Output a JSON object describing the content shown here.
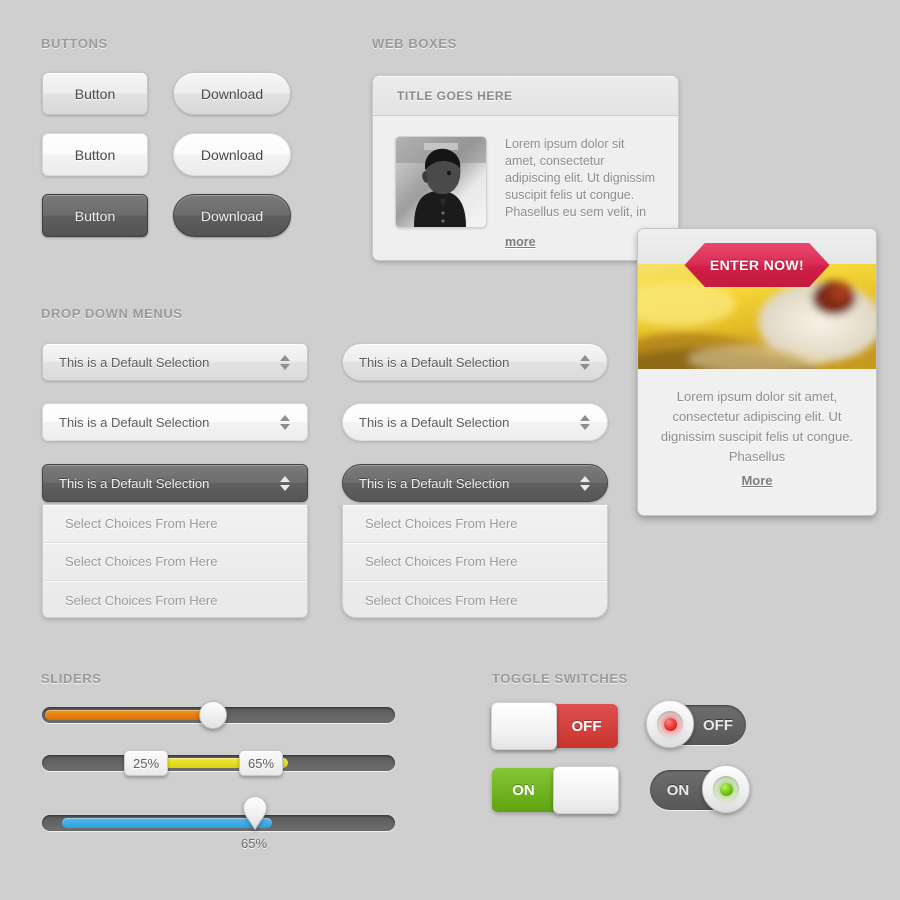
{
  "sections": {
    "buttons": "BUTTONS",
    "web_boxes": "WEB BOXES",
    "drop_downs": "DROP DOWN MENUS",
    "sliders": "SLIDERS",
    "toggles": "TOGGLE SWITCHES"
  },
  "buttons": {
    "square": [
      "Button",
      "Button",
      "Button"
    ],
    "rounded": [
      "Download",
      "Download",
      "Download"
    ]
  },
  "web_box": {
    "title": "TITLE GOES HERE",
    "body": "Lorem ipsum dolor sit amet, consectetur adipiscing elit. Ut dignissim suscipit felis ut congue. Phasellus eu sem velit, in",
    "more_label": "more",
    "thumb_alt": "portrait-photo"
  },
  "promo_card": {
    "badge_label": "ENTER NOW!",
    "badge_color": "#d42a52",
    "body": "Lorem ipsum dolor sit amet, consectetur adipiscing elit. Ut dignissim suscipit felis ut congue. Phasellus",
    "more_label": "More",
    "image_alt": "dessert-photo"
  },
  "dropdowns": {
    "selected_label": "This is a Default Selection",
    "options": [
      "Select Choices From Here",
      "Select Choices From Here",
      "Select Choices From Here"
    ],
    "arrow_icon": "chevron-up-down-icon"
  },
  "sliders": [
    {
      "name": "orange-slider",
      "value": 45,
      "fill_color": "#e8820f",
      "handle": "round"
    },
    {
      "name": "range-slider",
      "min_value": 25,
      "max_value": 65,
      "min_label": "25%",
      "max_label": "65%",
      "fill_color": "#e3dc24",
      "handle": "bubble"
    },
    {
      "name": "blue-slider",
      "value": 65,
      "value_label": "65%",
      "fill_color": "#43abe6",
      "handle": "pin"
    }
  ],
  "toggles": [
    {
      "name": "rect-off-toggle",
      "state": "off",
      "label": "OFF",
      "color": "#d44038"
    },
    {
      "name": "pill-off-toggle",
      "state": "off",
      "label": "OFF",
      "led_color": "#e02020"
    },
    {
      "name": "rect-on-toggle",
      "state": "on",
      "label": "ON",
      "color": "#72b821"
    },
    {
      "name": "pill-on-toggle",
      "state": "on",
      "label": "ON",
      "led_color": "#74c400"
    }
  ]
}
